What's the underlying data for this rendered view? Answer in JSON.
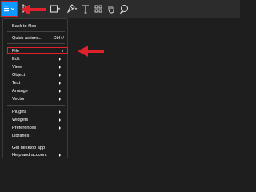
{
  "menu": {
    "back": "Back to files",
    "quick_actions": "Quick actions...",
    "quick_actions_shortcut": "Ctrl+/",
    "items_group1": [
      {
        "label": "File"
      },
      {
        "label": "Edit"
      },
      {
        "label": "View"
      },
      {
        "label": "Object"
      },
      {
        "label": "Text"
      },
      {
        "label": "Arrange"
      },
      {
        "label": "Vector"
      }
    ],
    "items_group2": [
      {
        "label": "Plugins"
      },
      {
        "label": "Widgets"
      },
      {
        "label": "Preferences"
      },
      {
        "label": "Libraries"
      }
    ],
    "get_desktop_app": "Get desktop app",
    "help_account": "Help and account"
  },
  "colors": {
    "toolbar_bg": "#2c2c2c",
    "canvas_bg": "#1e1e1e",
    "accent": "#0d99ff",
    "highlight": "#e0202b"
  },
  "icons": [
    "main-menu-icon",
    "move-tool-icon",
    "frame-tool-icon",
    "pen-tool-icon",
    "text-tool-icon",
    "hand-tool-icon",
    "comment-tool-icon"
  ]
}
